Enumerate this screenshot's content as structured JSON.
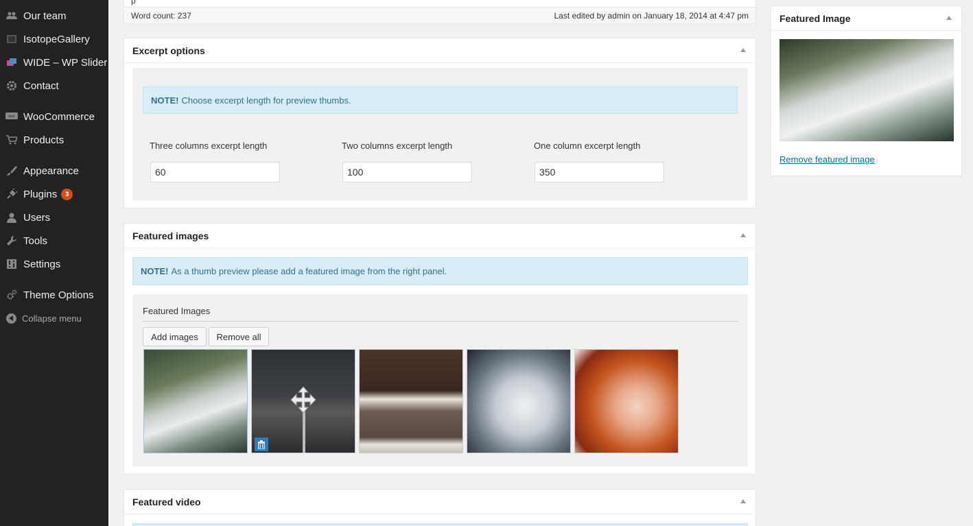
{
  "sidebar": {
    "items": [
      {
        "label": "Our team",
        "icon": "team-icon"
      },
      {
        "label": "IsotopeGallery",
        "icon": "gallery-icon"
      },
      {
        "label": "WIDE – WP Slider",
        "icon": "slider-icon"
      },
      {
        "label": "Contact",
        "icon": "gear-icon"
      },
      {
        "label": "WooCommerce",
        "icon": "woocommerce-icon"
      },
      {
        "label": "Products",
        "icon": "cart-icon"
      },
      {
        "label": "Appearance",
        "icon": "brush-icon"
      },
      {
        "label": "Plugins",
        "icon": "plug-icon",
        "badge": "3"
      },
      {
        "label": "Users",
        "icon": "user-icon"
      },
      {
        "label": "Tools",
        "icon": "wrench-icon"
      },
      {
        "label": "Settings",
        "icon": "settings-icon"
      },
      {
        "label": "Theme Options",
        "icon": "theme-gears-icon"
      }
    ],
    "collapse_label": "Collapse menu"
  },
  "editor": {
    "word_count": "Word count: 237",
    "last_edited": "Last edited by admin on January 18, 2014 at 4:47 pm",
    "stub_text": "p"
  },
  "excerpt": {
    "title": "Excerpt options",
    "note_bold": "NOTE!",
    "note_text": "Choose excerpt length for preview thumbs.",
    "fields": [
      {
        "label": "Three columns excerpt length",
        "value": "60"
      },
      {
        "label": "Two columns excerpt length",
        "value": "100"
      },
      {
        "label": "One column excerpt length",
        "value": "350"
      }
    ]
  },
  "featured_images": {
    "title": "Featured images",
    "note_bold": "NOTE!",
    "note_text": "As a thumb preview please add a featured image from the right panel.",
    "subtitle": "Featured Images",
    "add_label": "Add images",
    "remove_label": "Remove all",
    "thumbs": [
      "airplane",
      "city road",
      "bed",
      "car",
      "woman"
    ]
  },
  "featured_video": {
    "title": "Featured video"
  },
  "featured_image_side": {
    "title": "Featured Image",
    "remove_link": "Remove featured image"
  },
  "colors": {
    "sidebar_bg": "#222222",
    "note_bg": "#d9edf7",
    "note_text": "#31708f",
    "badge": "#d54e21",
    "link": "#0074a2"
  }
}
